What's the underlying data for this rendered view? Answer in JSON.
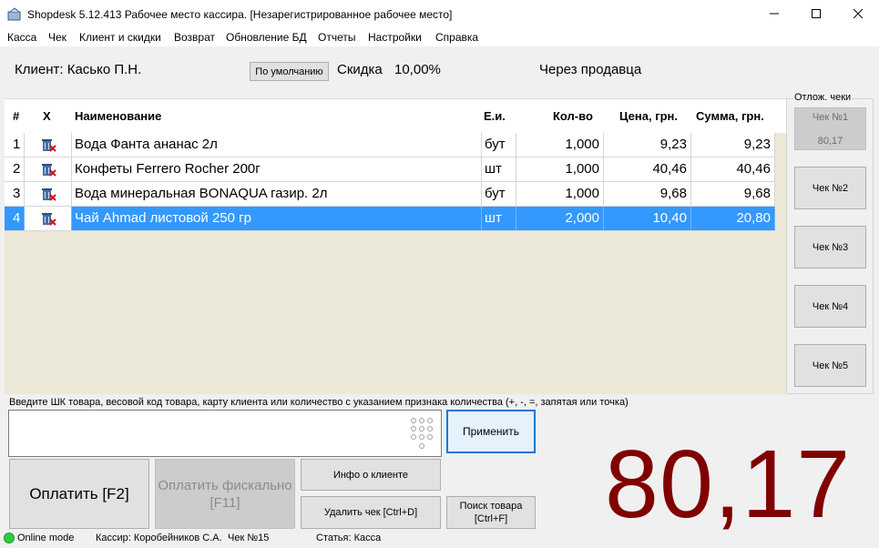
{
  "window": {
    "title": "Shopdesk 5.12.413 Рабочее место кассира. [Незарегистрированное рабочее место]"
  },
  "menu": [
    "Касса",
    "Чек",
    "Клиент и скидки",
    "Возврат",
    "Обновление БД",
    "Отчеты",
    "Настройки",
    "Справка"
  ],
  "client": {
    "label": "Клиент: Касько П.Н.",
    "default_button": "По умолчанию",
    "discount_label": "Скидка",
    "discount_value": "10,00%",
    "seller_mode": "Через продавца"
  },
  "table": {
    "columns": [
      "#",
      "X",
      "Наименование",
      "Е.и.",
      "Кол-во",
      "Цена, грн.",
      "Сумма, грн."
    ],
    "rows": [
      {
        "n": "1",
        "name": "Вода Фанта ананас 2л",
        "unit": "бут",
        "qty": "1,000",
        "price": "9,23",
        "sum": "9,23"
      },
      {
        "n": "2",
        "name": "Конфеты Ferrero Rocher 200г",
        "unit": "шт",
        "qty": "1,000",
        "price": "40,46",
        "sum": "40,46"
      },
      {
        "n": "3",
        "name": "Вода минеральная BONAQUA газир. 2л",
        "unit": "бут",
        "qty": "1,000",
        "price": "9,68",
        "sum": "9,68"
      },
      {
        "n": "4",
        "name": "Чай Ahmad листовой 250 гр",
        "unit": "шт",
        "qty": "2,000",
        "price": "10,40",
        "sum": "20,80"
      }
    ]
  },
  "parked": {
    "title": "Отлож. чеки",
    "checks": [
      {
        "label": "Чек №1",
        "amount": "80,17"
      },
      {
        "label": "Чек №2",
        "amount": ""
      },
      {
        "label": "Чек №3",
        "amount": ""
      },
      {
        "label": "Чек №4",
        "amount": ""
      },
      {
        "label": "Чек №5",
        "amount": ""
      }
    ]
  },
  "input": {
    "hint": "Введите ШК товара, весовой код товара,  карту клиента или количество с указанием признака количества (+, -, =, запятая или точка)",
    "value": "",
    "apply_button": "Применить"
  },
  "buttons": {
    "pay": "Оплатить [F2]",
    "pay_fiscal": "Оплатить фискально [F11]",
    "client_info": "Инфо о клиенте",
    "delete_check": "Удалить чек [Ctrl+D]",
    "find_product": "Поиск товара [Ctrl+F]"
  },
  "total": "80,17",
  "status": {
    "mode": "Online mode",
    "cashier": "Кассир: Коробейников С.А.",
    "check": "Чек №15",
    "article": "Статья: Касса"
  },
  "colors": {
    "selected_row": "#3399ff",
    "total": "#800000",
    "online": "#2ecc40"
  }
}
